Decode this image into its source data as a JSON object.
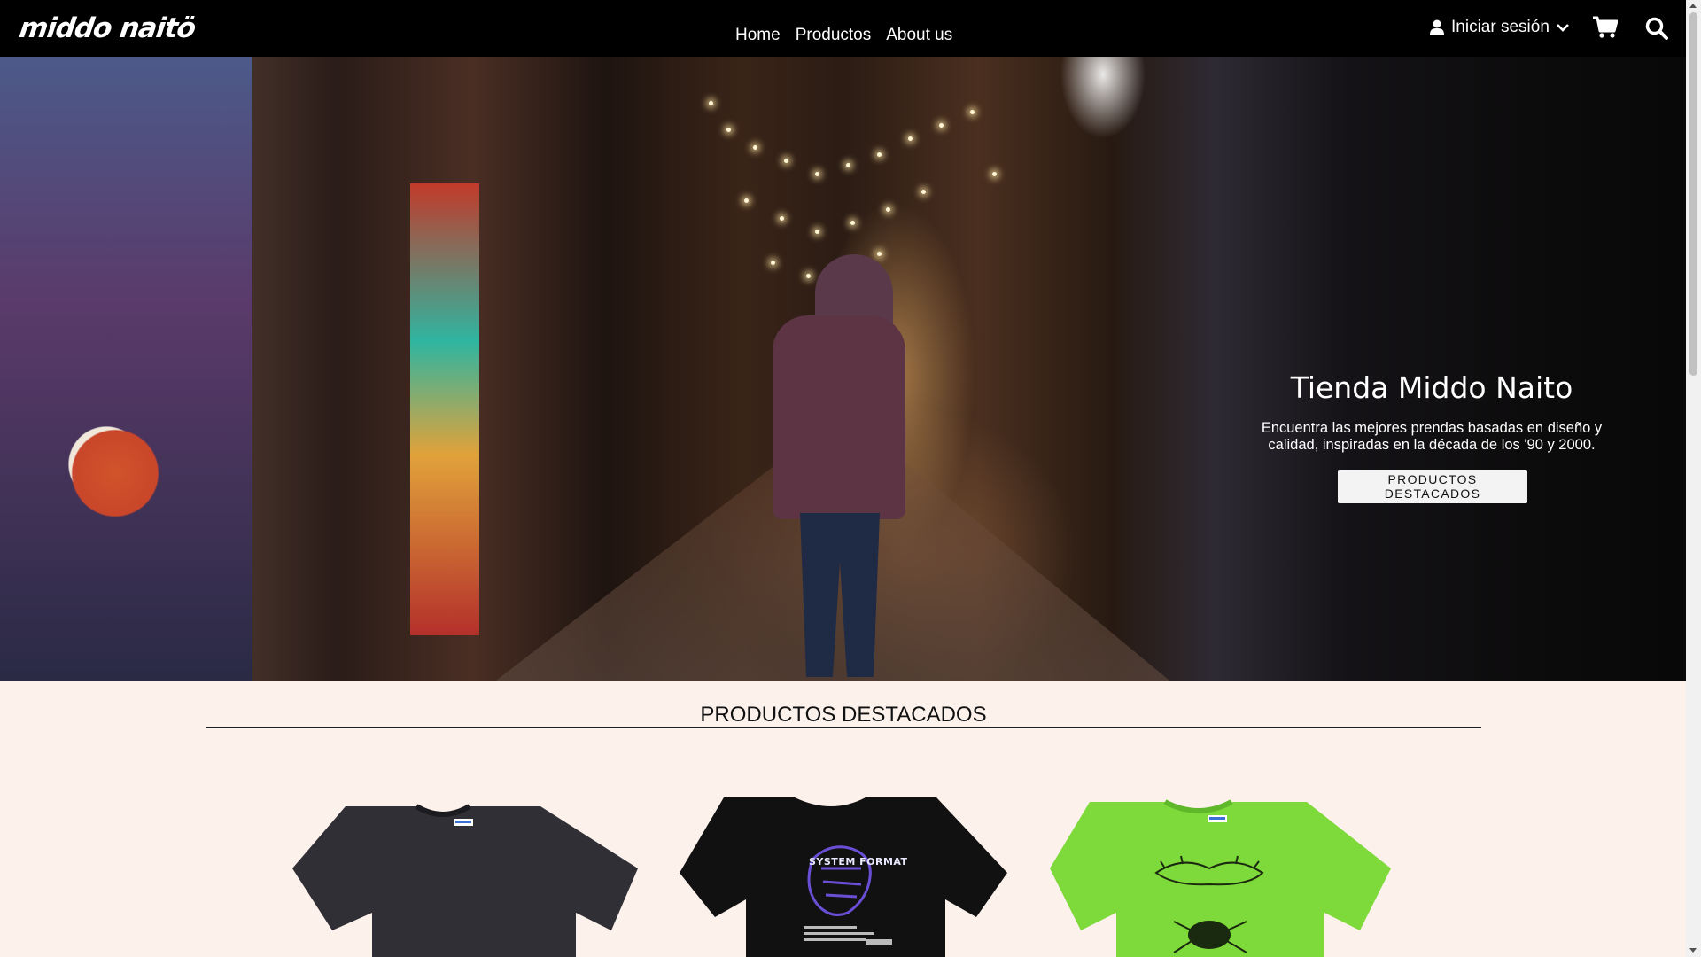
{
  "navbar": {
    "logo": "middo naitö",
    "links": [
      "Home",
      "Productos",
      "About us"
    ],
    "login_label": "Iniciar sesión",
    "icons": [
      "user-icon",
      "chevron-down-icon",
      "cart-icon",
      "search-icon"
    ]
  },
  "hero": {
    "title": "Tienda Middo Naito",
    "subtitle": "Encuentra las mejores prendas basadas en diseño y calidad, inspiradas en la década de los '90 y 2000.",
    "button": "PRODUCTOS DESTACADOS"
  },
  "featured": {
    "title": "PRODUCTOS DESTACADOS",
    "products": [
      {
        "color": "#2f2f35",
        "print": ""
      },
      {
        "color": "#111111",
        "print": "SYSTEM FORMAT"
      },
      {
        "color": "#7ed93a",
        "print": ""
      }
    ]
  },
  "colors": {
    "navbar_bg": "#000000",
    "page_bg": "#fdf1ec",
    "button_bg": "#f3f3f3"
  }
}
